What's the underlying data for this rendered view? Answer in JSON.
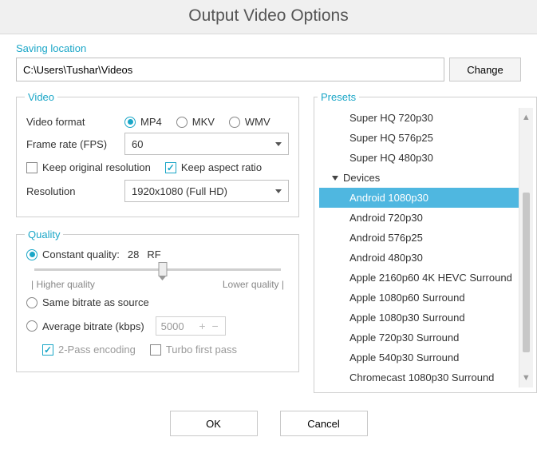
{
  "title": "Output Video Options",
  "saving": {
    "label": "Saving location",
    "path": "C:\\Users\\Tushar\\Videos",
    "change_btn": "Change"
  },
  "video": {
    "legend": "Video",
    "format_label": "Video format",
    "formats": {
      "mp4": "MP4",
      "mkv": "MKV",
      "wmv": "WMV"
    },
    "format_selected": "mp4",
    "fps_label": "Frame rate (FPS)",
    "fps_value": "60",
    "keep_original": "Keep original resolution",
    "keep_original_checked": false,
    "keep_aspect": "Keep aspect ratio",
    "keep_aspect_checked": true,
    "resolution_label": "Resolution",
    "resolution_value": "1920x1080 (Full HD)"
  },
  "quality": {
    "legend": "Quality",
    "mode_selected": "constant",
    "constant_label": "Constant quality:",
    "constant_value": "28",
    "constant_unit": "RF",
    "slider_left": "|  Higher quality",
    "slider_right": "Lower quality  |",
    "same_label": "Same bitrate as source",
    "avg_label": "Average bitrate (kbps)",
    "avg_value": "5000",
    "twopass_label": "2-Pass encoding",
    "twopass_checked": true,
    "turbo_label": "Turbo first pass",
    "turbo_checked": false
  },
  "presets": {
    "legend": "Presets",
    "group_label": "Devices",
    "items_top": [
      "Super HQ 720p30",
      "Super HQ 576p25",
      "Super HQ 480p30"
    ],
    "items_devices": [
      "Android 1080p30",
      "Android 720p30",
      "Android 576p25",
      "Android 480p30",
      "Apple 2160p60 4K HEVC Surround",
      "Apple 1080p60 Surround",
      "Apple 1080p30 Surround",
      "Apple 720p30 Surround",
      "Apple 540p30 Surround",
      "Chromecast 1080p30 Surround"
    ],
    "selected": "Android 1080p30"
  },
  "footer": {
    "ok": "OK",
    "cancel": "Cancel"
  }
}
